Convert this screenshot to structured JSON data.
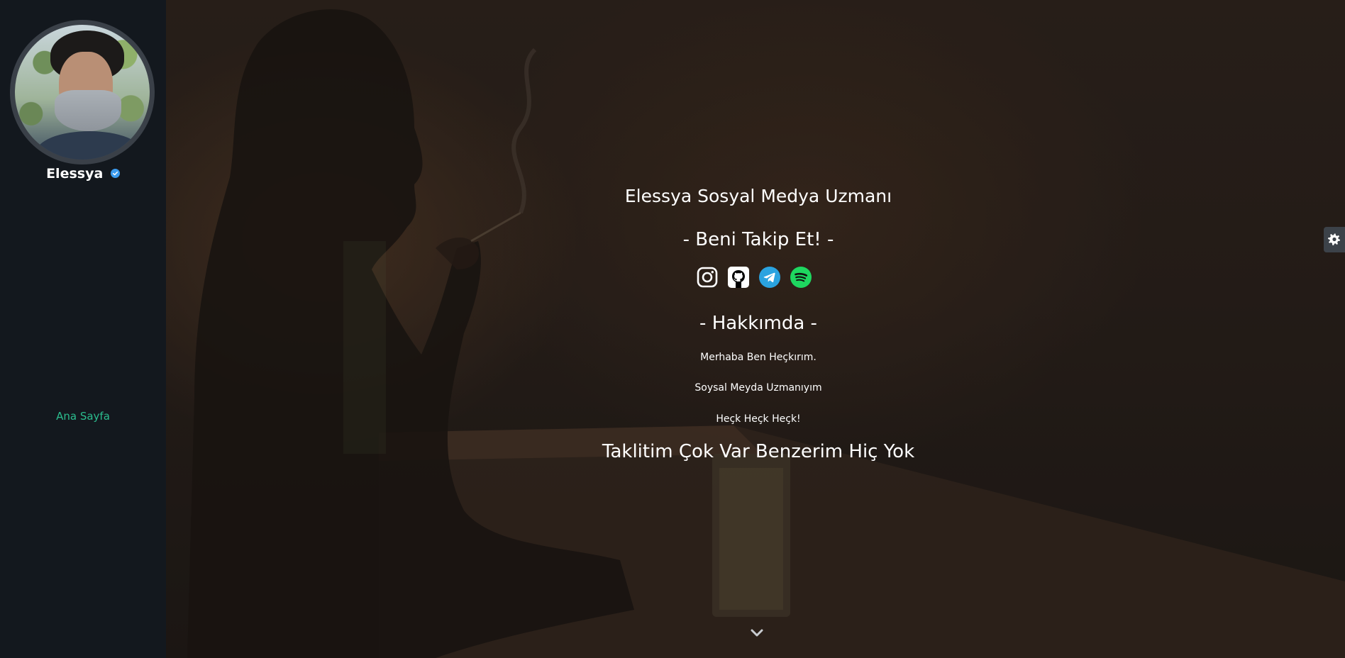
{
  "sidebar": {
    "username": "Elessya",
    "nav_home": "Ana Sayfa"
  },
  "hero": {
    "title": "Elessya Sosyal Medya Uzmanı",
    "follow_heading": "- Beni Takip Et! -",
    "socials": [
      {
        "name": "instagram-icon",
        "color": "#ffffff"
      },
      {
        "name": "github-icon",
        "color": "#ffffff"
      },
      {
        "name": "telegram-icon",
        "color": "#2aa3e0"
      },
      {
        "name": "spotify-icon",
        "color": "#1ed760"
      }
    ],
    "about_heading": "- Hakkımda -",
    "about_lines": [
      "Merhaba Ben Heçkırım.",
      "Soysal Meyda Uzmanıyım",
      "Heçk Heçk Heçk!"
    ],
    "motto": "Taklitim Çok Var Benzerim Hiç Yok"
  },
  "colors": {
    "sidebar_bg": "#13181e",
    "accent": "#2bbd8e",
    "verified": "#3b9cf0"
  }
}
